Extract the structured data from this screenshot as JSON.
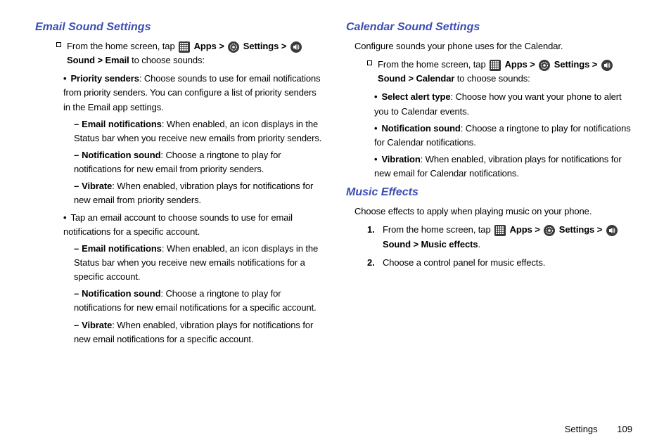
{
  "left": {
    "heading": "Email Sound Settings",
    "lead_prefix": "From the home screen, tap ",
    "lead_apps": "Apps >",
    "lead_settings": "Settings >",
    "lead_sound": "Sound > Email",
    "lead_suffix": " to choose sounds:",
    "b1_bold": "Priority senders",
    "b1_rest": ": Choose sounds to use for email notifications from priority senders. You can configure a list of priority senders in the Email app settings.",
    "b1a_bold": "Email notifications",
    "b1a_rest": ": When enabled, an icon displays in the Status bar when you receive new emails from priority senders.",
    "b1b_bold": "Notification sound",
    "b1b_rest": ": Choose a ringtone to play for notifications for new email from priority senders.",
    "b1c_bold": "Vibrate",
    "b1c_rest": ": When enabled, vibration plays for notifications for new email from priority senders.",
    "b2": "Tap an email account to choose sounds to use for email notifications for a specific account.",
    "b2a_bold": "Email notifications",
    "b2a_rest": ": When enabled, an icon displays in the Status bar when you receive new emails notifications for a specific account.",
    "b2b_bold": "Notification sound",
    "b2b_rest": ": Choose a ringtone to play for notifications for new email notifications for a specific account.",
    "b2c_bold": "Vibrate",
    "b2c_rest": ": When enabled, vibration plays for notifications for new email notifications for a specific account."
  },
  "right": {
    "cal_heading": "Calendar Sound Settings",
    "cal_intro": "Configure sounds your phone uses for the Calendar.",
    "cal_lead_prefix": "From the home screen, tap ",
    "cal_lead_apps": "Apps >",
    "cal_lead_settings": "Settings >",
    "cal_lead_sound": "Sound > Calendar",
    "cal_lead_suffix": " to choose sounds:",
    "cal_b1_bold": "Select alert type",
    "cal_b1_rest": ": Choose how you want your phone to alert you to Calendar events.",
    "cal_b2_bold": "Notification sound",
    "cal_b2_rest": ": Choose a ringtone to play for notifications for Calendar notifications.",
    "cal_b3_bold": "Vibration",
    "cal_b3_rest": ": When enabled, vibration plays for notifications for new email for Calendar notifications.",
    "mus_heading": "Music Effects",
    "mus_intro": "Choose effects to apply when playing  music on your phone.",
    "mus_n1": "1.",
    "mus_1_prefix": "From the home screen, tap ",
    "mus_1_apps": "Apps >",
    "mus_1_settings": "Settings >",
    "mus_1_sound": "Sound > Music effects",
    "mus_1_dot": ".",
    "mus_n2": "2.",
    "mus_2": "Choose a control panel for music effects."
  },
  "footer": {
    "section": "Settings",
    "page": "109"
  }
}
